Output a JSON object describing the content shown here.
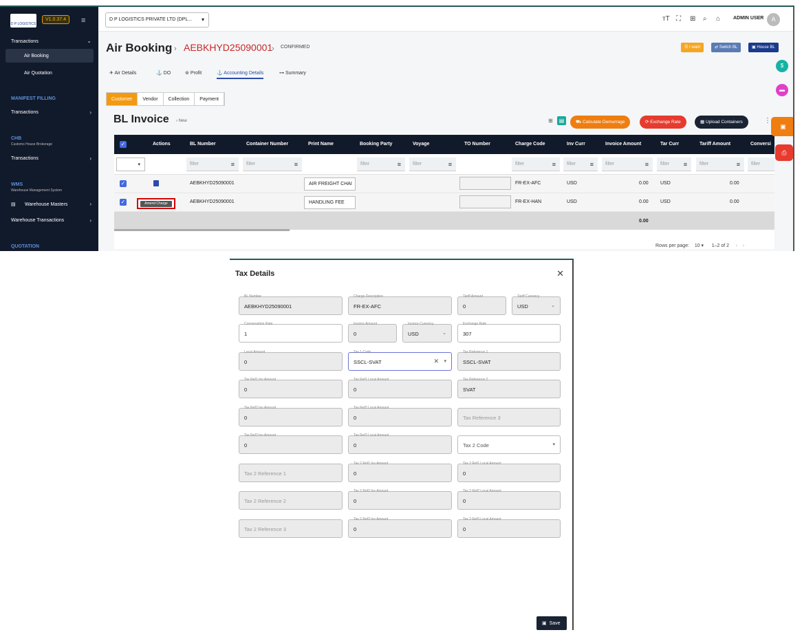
{
  "sidebar": {
    "logo_text": "D P LOGISTICS",
    "version": "V1.0.37.4",
    "sections": {
      "transactions": "Transactions",
      "air_booking": "Air Booking",
      "air_quotation": "Air Quotation",
      "manifest": "MANIFEST FILLING",
      "manifest_tx": "Transactions",
      "chb": "CHB",
      "chb_sub": "Customs House Brokerage",
      "chb_tx": "Transactions",
      "wms": "WMS",
      "wms_sub": "Warehouse Management System",
      "wh_masters": "Warehouse Masters",
      "wh_tx": "Warehouse Transactions",
      "quotation": "QUOTATION"
    }
  },
  "topbar": {
    "company": "D P LOGISTICS PRIVATE LTD (DPL...",
    "user": "ADMIN USER",
    "avatar": "A"
  },
  "header": {
    "title": "Air Booking",
    "booking_no": "AEBKHYD25090001",
    "status": "CONFIRMED",
    "btn_iwant": "I want",
    "btn_switch": "Switch BL",
    "btn_house": "House BL"
  },
  "tabs": [
    "Air Details",
    "DO",
    "Profit",
    "Accounting Details",
    "Summary"
  ],
  "subtabs": [
    "Customer",
    "Vendor",
    "Collection",
    "Payment"
  ],
  "invoice": {
    "title": "BL Invoice",
    "crumb": "New",
    "btn_demurrage": "Calculate Demurrage",
    "btn_exchange": "Exchange Rate",
    "btn_upload": "Upload Containers"
  },
  "grid": {
    "columns": [
      "Actions",
      "BL Number",
      "Container Number",
      "Print Name",
      "Booking Party",
      "Voyage",
      "TO Number",
      "Charge Code",
      "Inv Curr",
      "Invoice Amount",
      "Tar Curr",
      "Tariff Amount",
      "Conversi"
    ],
    "filter_placeholder": "filter",
    "rows": [
      {
        "bl": "AEBKHYD25090001",
        "print_name": "AIR FREIGHT CHAI",
        "charge": "FR-EX-AFC",
        "inv_curr": "USD",
        "inv_amt": "0.00",
        "tar_curr": "USD",
        "tar_amt": "0.00"
      },
      {
        "bl": "AEBKHYD25090001",
        "print_name": "HANDLING FEE",
        "charge": "FR-EX-HAN",
        "inv_curr": "USD",
        "inv_amt": "0.00",
        "tar_curr": "USD",
        "tar_amt": "0.00"
      }
    ],
    "total": "0.00",
    "tooltip": "Amend Charge",
    "rows_per_page_label": "Rows per page:",
    "rows_per_page": "10",
    "page_info": "1–2 of 2"
  },
  "modal": {
    "title": "Tax Details",
    "save": "Save",
    "fields": {
      "bl_number": {
        "label": "BL Number",
        "value": "AEBKHYD25090001"
      },
      "charge_desc": {
        "label": "Charge Description",
        "value": "FR-EX-AFC"
      },
      "tariff_amount": {
        "label": "Tariff Amount",
        "value": "0"
      },
      "tariff_currency": {
        "label": "Tariff Currency",
        "value": "USD"
      },
      "conv_rate": {
        "label": "Conversation Rate",
        "value": "1"
      },
      "invoice_amount": {
        "label": "Invoice Amount",
        "value": "0"
      },
      "invoice_currency": {
        "label": "Invoice Currency",
        "value": "USD"
      },
      "exchange_rate": {
        "label": "Exchange Rate",
        "value": "307"
      },
      "local_amount": {
        "label": "Local Amount",
        "value": "0"
      },
      "tax1_code": {
        "label": "Tax 1 Code",
        "value": "SSCL-SVAT"
      },
      "tax_ref1": {
        "label": "Tax Reference 1",
        "value": "SSCL-SVAT"
      },
      "tax_ref1_inv": {
        "label": "Tax Ref1 Inv Amount",
        "value": "0"
      },
      "tax_ref1_local": {
        "label": "Tax Ref1 Local Amount",
        "value": "0"
      },
      "tax_ref2": {
        "label": "Tax Reference 2",
        "value": "SVAT"
      },
      "tax_ref2_inv": {
        "label": "Tax Ref2 Inv Amount",
        "value": "0"
      },
      "tax_ref2_local": {
        "label": "Tax Ref2 Local Amount",
        "value": "0"
      },
      "tax_ref3_ph": "Tax Reference 3",
      "tax_ref3_inv": {
        "label": "Tax Ref3 Inv Amount",
        "value": "0"
      },
      "tax_ref3_local": {
        "label": "Tax Ref3 Local Amount",
        "value": "0"
      },
      "tax2_code_ph": "Tax 2 Code",
      "tax2_ref1_ph": "Tax 2 Reference 1",
      "tax2_ref1_inv": {
        "label": "Tax 2 Ref1 Inv Amount",
        "value": "0"
      },
      "tax2_ref1_local": {
        "label": "Tax 2 Ref1 Local Amount",
        "value": "0"
      },
      "tax2_ref2_ph": "Tax 2 Reference 2",
      "tax2_ref2_inv": {
        "label": "Tax 2 Ref2 Inv Amount",
        "value": "0"
      },
      "tax2_ref2_local": {
        "label": "Tax 2 Ref2 Local Amount",
        "value": "0"
      },
      "tax2_ref3_ph": "Tax 2 Reference 3",
      "tax2_ref3_inv": {
        "label": "Tax 2 Ref3 Inv Amount",
        "value": "0"
      },
      "tax2_ref3_local": {
        "label": "Tax 2 Ref3 Local Amount",
        "value": "0"
      }
    }
  },
  "colors": {
    "accent": "#f29a12",
    "nav": "#111a2b",
    "link": "#2b4ca8",
    "error": "#c62828"
  }
}
